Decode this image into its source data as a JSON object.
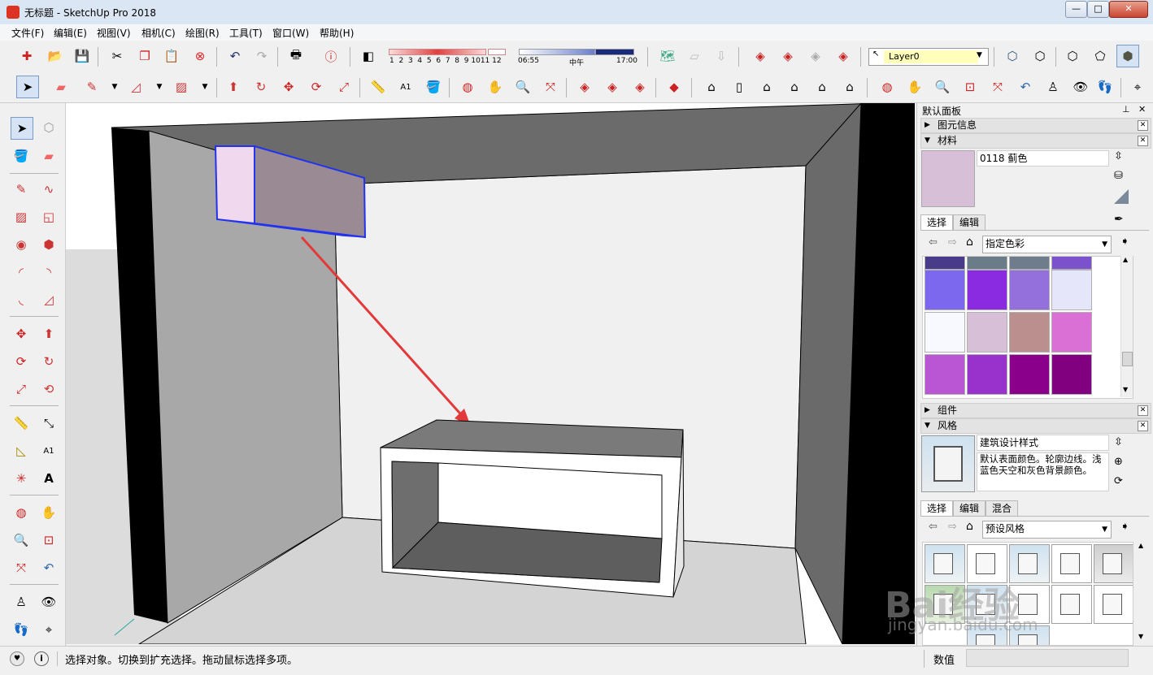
{
  "window": {
    "title": "无标题 - SketchUp Pro 2018",
    "minimize": "—",
    "maximize": "□",
    "close": "✕"
  },
  "menu": [
    "文件(F)",
    "编辑(E)",
    "视图(V)",
    "相机(C)",
    "绘图(R)",
    "工具(T)",
    "窗口(W)",
    "帮助(H)"
  ],
  "shadow": {
    "months": [
      "1",
      "2",
      "3",
      "4",
      "5",
      "6",
      "7",
      "8",
      "9",
      "10",
      "11",
      "12"
    ],
    "time_start": "06:55",
    "time_mid": "中午",
    "time_end": "17:00"
  },
  "layer": {
    "name": "Layer0"
  },
  "panel": {
    "title": "默认面板",
    "entity_info": {
      "label": "图元信息"
    },
    "materials": {
      "label": "材料",
      "current_name": "0118 蓟色",
      "current_color": "#d8bfd8",
      "tab_select": "选择",
      "tab_edit": "编辑",
      "library": "指定色彩",
      "swatch_rows": [
        [
          "#4a3a8a",
          "#6a7c88",
          "#6e7c8c",
          "#7b52cc"
        ],
        [
          "#7b68ee",
          "#8a2be2",
          "#9370db",
          "#e6e6fa"
        ],
        [
          "#f8f8ff",
          "#d8bfd8",
          "#bc8f8f",
          "#da70d6"
        ],
        [
          "#ba55d3",
          "#9932cc",
          "#8b008b",
          "#800080"
        ]
      ]
    },
    "components": {
      "label": "组件"
    },
    "styles": {
      "label": "风格",
      "name": "建筑设计样式",
      "description": "默认表面颜色。轮廓边线。浅蓝色天空和灰色背景颜色。",
      "tab_select": "选择",
      "tab_edit": "编辑",
      "tab_mix": "混合",
      "library": "预设风格"
    }
  },
  "status": {
    "message": "选择对象。切换到扩充选择。拖动鼠标选择多项。",
    "measurements_label": "数值",
    "measurements_value": ""
  },
  "watermark": {
    "brand": "Bai经验",
    "url": "jingyan.baidu.com"
  }
}
